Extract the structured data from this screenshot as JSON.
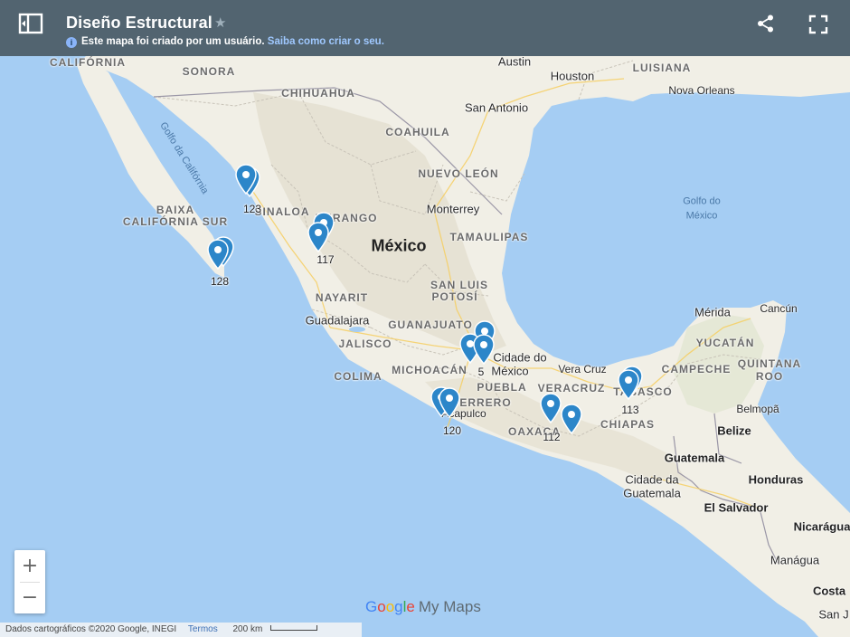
{
  "header": {
    "title": "Diseño Estructural",
    "subtitle_text": "Este mapa foi criado por um usuário.",
    "subtitle_link": "Saiba como criar o seu.",
    "bg_color": "#526470"
  },
  "icons": {
    "panel": "panel-toggle-icon",
    "star": "star-icon",
    "info": "info-icon",
    "share": "share-icon",
    "fullscreen": "fullscreen-icon",
    "pin": "map-pin-icon"
  },
  "map": {
    "country_label": "México",
    "state_labels": [
      "CALIFÓRNIA",
      "SONORA",
      "CHIHUAHUA",
      "COAHUILA",
      "NUEVO LEÓN",
      "BAIXA",
      "CALIFÓRNIA SUR",
      "SINALOA",
      "DURANGO",
      "TAMAULIPAS",
      "SAN LUIS",
      "POTOSÍ",
      "NAYARIT",
      "GUANAJUATO",
      "JALISCO",
      "COLIMA",
      "MICHOACÁN",
      "PUEBLA",
      "VERACRUZ",
      "GUERRERO",
      "OAXACA",
      "CHIAPAS",
      "TABASCO",
      "CAMPECHE",
      "YUCATÁN",
      "QUINTANA",
      "ROO",
      "LUISIANA"
    ],
    "city_labels": [
      "Austin",
      "Houston",
      "San Antonio",
      "Nova Orleans",
      "Monterrey",
      "Guadalajara",
      "Cidade do",
      "México",
      "Vera Cruz",
      "Acapulco",
      "Mérida",
      "Cancún",
      "Belmopã",
      "Belize",
      "Guatemala",
      "Cidade da",
      "Guatemala",
      "Honduras",
      "El Salvador",
      "Nicarágua",
      "Manágua",
      "Costa",
      "San J"
    ],
    "water_labels": [
      "Golfo do",
      "México",
      "Golfo da Califórnia"
    ],
    "pin_counts": [
      "123",
      "117",
      "128",
      "5",
      "120",
      "112",
      "113"
    ],
    "colors": {
      "water": "#a5cdf3",
      "land": "#f1efe6",
      "highlands": "#e4dfcf",
      "pin": "#2c86c9"
    }
  },
  "controls": {
    "zoom_in": "+",
    "zoom_out": "−"
  },
  "brand": {
    "g1": "G",
    "g2": "o",
    "g3": "o",
    "g4": "g",
    "g5": "l",
    "g6": "e",
    "mymaps": "My Maps"
  },
  "footer": {
    "attribution": "Dados cartográficos ©2020 Google, INEGI",
    "terms": "Termos",
    "scale": "200 km"
  }
}
